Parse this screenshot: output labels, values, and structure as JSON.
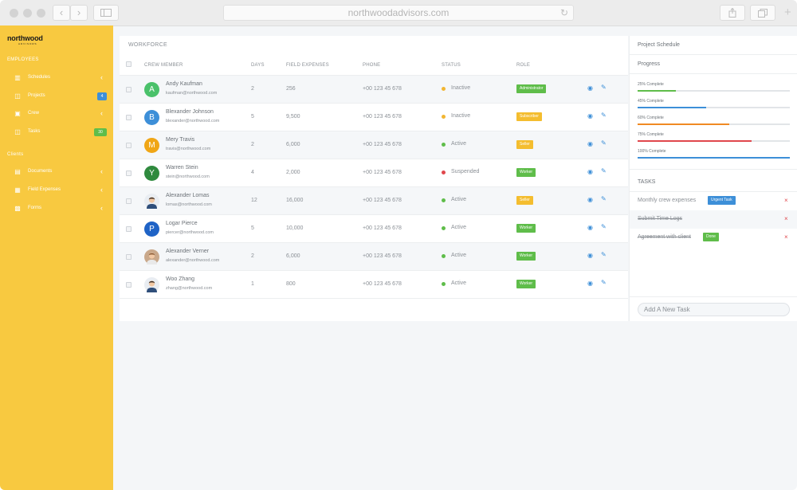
{
  "browser": {
    "url": "northwoodadvisors.com"
  },
  "sidebar": {
    "logo": "northwood",
    "logo_sub": "ADVISORS",
    "section_employees": "EMPLOYEES",
    "section_clients": "Clients",
    "employee_items": [
      {
        "label": "Schedules",
        "icon": "bar-chart-icon"
      },
      {
        "label": "Projects",
        "icon": "folder-icon",
        "badge": "4"
      },
      {
        "label": "Crew",
        "icon": "id-card-icon"
      },
      {
        "label": "Tasks",
        "icon": "folder-icon",
        "badge": "30"
      }
    ],
    "client_items": [
      {
        "label": "Documents",
        "icon": "document-icon"
      },
      {
        "label": "Field Expenses",
        "icon": "calendar-icon"
      },
      {
        "label": "Forms",
        "icon": "form-icon"
      }
    ]
  },
  "workforce": {
    "title": "WORKFORCE",
    "columns": [
      "CREW MEMBER",
      "DAYS",
      "FIELD EXPENSES",
      "PHONE",
      "STATUS",
      "ROLE"
    ],
    "rows": [
      {
        "initial": "A",
        "avatar_color": "#4ac16a",
        "name": "Andy Kaufman",
        "email": "kaufman@northwood.com",
        "days": "2",
        "expenses": "256",
        "phone": "+00 123 45 678",
        "status": "Inactive",
        "status_color": "#f2b632",
        "role": "Administrator",
        "role_color": "#5fbd4a"
      },
      {
        "initial": "B",
        "avatar_color": "#3d8fd8",
        "name": "Blexander Johnson",
        "email": "blexander@northwood.com",
        "days": "5",
        "expenses": "9,500",
        "phone": "+00 123 45 678",
        "status": "Inactive",
        "status_color": "#f2b632",
        "role": "Subscriber",
        "role_color": "#f4bd2f"
      },
      {
        "initial": "M",
        "avatar_color": "#f0a616",
        "name": "Mery Travis",
        "email": "travis@northwood.com",
        "days": "2",
        "expenses": "6,000",
        "phone": "+00 123 45 678",
        "status": "Active",
        "status_color": "#5fbd4a",
        "role": "Seller",
        "role_color": "#f4bd2f"
      },
      {
        "initial": "Y",
        "avatar_color": "#2f8a3e",
        "name": "Warren Stein",
        "email": "stein@northwood.com",
        "days": "4",
        "expenses": "2,000",
        "phone": "+00 123 45 678",
        "status": "Suspended",
        "status_color": "#e0474c",
        "role": "Worker",
        "role_color": "#5fbd4a"
      },
      {
        "initial": "",
        "avatar_color": "photo",
        "name": "Alexander Lomas",
        "email": "lomas@northwood.com",
        "days": "12",
        "expenses": "16,000",
        "phone": "+00 123 45 678",
        "status": "Active",
        "status_color": "#5fbd4a",
        "role": "Seller",
        "role_color": "#f4bd2f"
      },
      {
        "initial": "P",
        "avatar_color": "#1f63c6",
        "name": "Logar Pierce",
        "email": "piercer@northwood.com",
        "days": "5",
        "expenses": "10,000",
        "phone": "+00 123 45 678",
        "status": "Active",
        "status_color": "#5fbd4a",
        "role": "Worker",
        "role_color": "#5fbd4a"
      },
      {
        "initial": "",
        "avatar_color": "photo",
        "name": "Alexander Verner",
        "email": "alexander@northwood.com",
        "days": "2",
        "expenses": "6,000",
        "phone": "+00 123 45 678",
        "status": "Active",
        "status_color": "#5fbd4a",
        "role": "Worker",
        "role_color": "#5fbd4a"
      },
      {
        "initial": "",
        "avatar_color": "photo",
        "name": "Woo Zhang",
        "email": "zhang@northwood.com",
        "days": "1",
        "expenses": "800",
        "phone": "+00 123 45 678",
        "status": "Active",
        "status_color": "#5fbd4a",
        "role": "Worker",
        "role_color": "#5fbd4a"
      }
    ]
  },
  "schedule": {
    "title": "Project Schedule",
    "progress_title": "Progress",
    "progress": [
      {
        "label": "25% Complete",
        "value": 0.25,
        "color": "#5fbd4a"
      },
      {
        "label": "45% Complete",
        "value": 0.45,
        "color": "#3d8fd8"
      },
      {
        "label": "60% Complete",
        "value": 0.6,
        "color": "#f08a24"
      },
      {
        "label": "75% Complete",
        "value": 0.75,
        "color": "#e0474c"
      },
      {
        "label": "100% Complete",
        "value": 1.0,
        "color": "#3d8fd8"
      }
    ]
  },
  "tasks": {
    "title": "TASKS",
    "items": [
      {
        "text": "Monthly crew expenses",
        "badge": "Urgent Task",
        "badge_color": "#3d8fd8",
        "done": false
      },
      {
        "text": "Submit Time Logs",
        "badge": "",
        "badge_color": "",
        "done": true
      },
      {
        "text": "Agreement with client",
        "badge": "Done",
        "badge_color": "#5fbd4a",
        "done": true
      }
    ],
    "add_placeholder": "Add A New Task"
  }
}
